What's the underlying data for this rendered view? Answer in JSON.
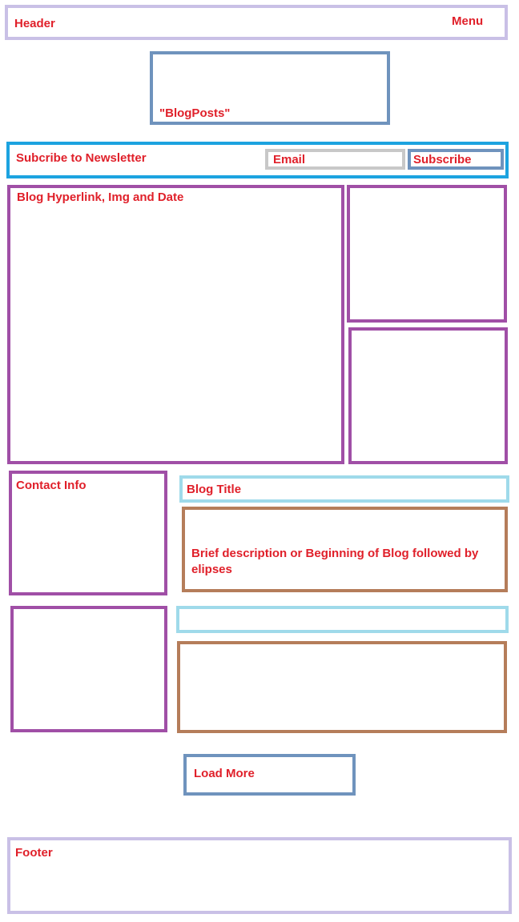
{
  "header": {
    "title": "Header",
    "menu": "Menu"
  },
  "blog_posts": {
    "label": "\"BlogPosts\""
  },
  "newsletter": {
    "label": "Subcribe to Newsletter",
    "email": "Email",
    "subscribe": "Subscribe"
  },
  "featured": {
    "label": "Blog Hyperlink, Img and Date"
  },
  "contact": {
    "label": "Contact Info"
  },
  "blog_entry": {
    "title": "Blog Title",
    "description": "Brief description or Beginning of Blog followed by elipses"
  },
  "load_more": {
    "label": "Load More"
  },
  "footer": {
    "label": "Footer"
  },
  "colors": {
    "label": "#e0202a",
    "lavender": "#c9c0e6",
    "slate_blue": "#6f93bd",
    "bright_blue": "#1ca3e0",
    "gray": "#c8c8c8",
    "purple": "#a04fa6",
    "light_cyan": "#9fdaea",
    "brown": "#b57d5a"
  }
}
